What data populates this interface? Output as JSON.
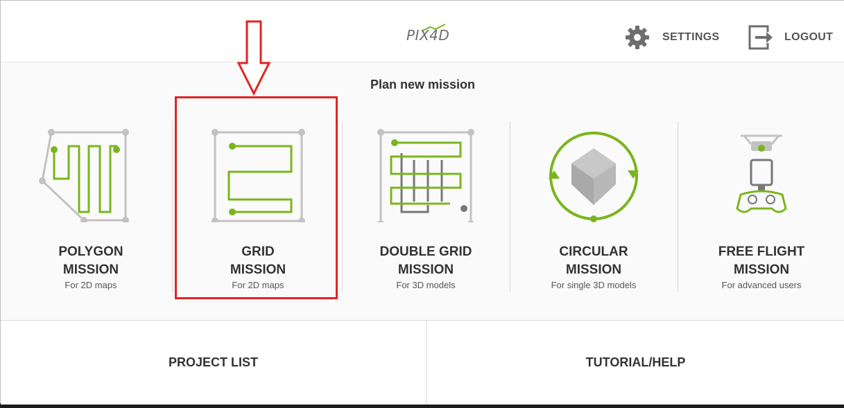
{
  "header": {
    "logo_text": "PIX4D",
    "settings_label": "SETTINGS",
    "logout_label": "LOGOUT"
  },
  "main": {
    "title": "Plan new mission",
    "missions": [
      {
        "name_line1": "POLYGON",
        "name_line2": "MISSION",
        "subtitle": "For 2D maps"
      },
      {
        "name_line1": "GRID",
        "name_line2": "MISSION",
        "subtitle": "For 2D maps"
      },
      {
        "name_line1": "DOUBLE GRID",
        "name_line2": "MISSION",
        "subtitle": "For 3D models"
      },
      {
        "name_line1": "CIRCULAR",
        "name_line2": "MISSION",
        "subtitle": "For single 3D models"
      },
      {
        "name_line1": "FREE FLIGHT",
        "name_line2": "MISSION",
        "subtitle": "For advanced users"
      }
    ]
  },
  "bottom": {
    "project_list_label": "PROJECT LIST",
    "tutorial_label": "TUTORIAL/HELP"
  },
  "colors": {
    "accent_green": "#7ab51d",
    "highlight_red": "#e02424",
    "gray": "#b5b5b5"
  }
}
